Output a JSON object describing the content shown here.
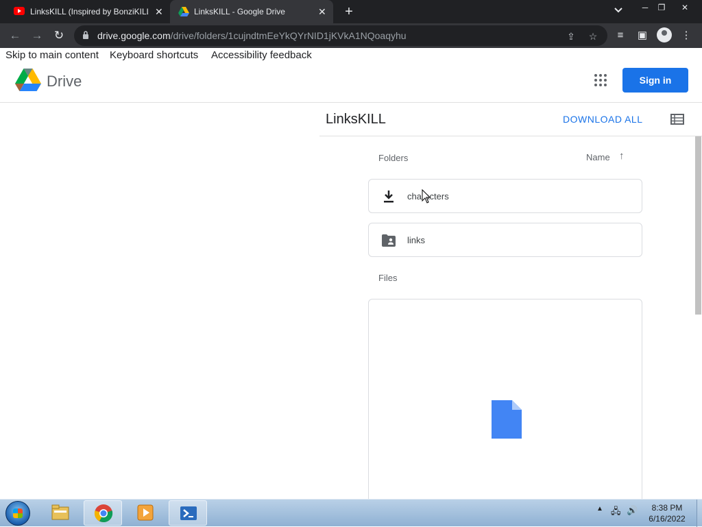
{
  "browser": {
    "tabs": [
      {
        "title": "LinksKILL (Inspired by BonziKILL)",
        "icon": "youtube-icon",
        "active": false
      },
      {
        "title": "LinksKILL - Google Drive",
        "icon": "google-drive-icon",
        "active": true
      }
    ],
    "url_domain": "drive.google.com",
    "url_path": "/drive/folders/1cujndtmEeYkQYrNID1jKVkA1NQoaqyhu"
  },
  "skip_links": [
    "Skip to main content",
    "Keyboard shortcuts",
    "Accessibility feedback"
  ],
  "header": {
    "logo_text": "Drive",
    "signin_label": "Sign in"
  },
  "folder": {
    "title": "LinksKILL",
    "download_all_label": "DOWNLOAD ALL"
  },
  "content": {
    "folders_label": "Folders",
    "sort_label": "Name",
    "files_label": "Files",
    "folders": [
      {
        "name": "characters",
        "icon": "download-icon"
      },
      {
        "name": "links",
        "icon": "shared-folder-icon"
      }
    ]
  },
  "taskbar": {
    "time": "8:38 PM",
    "date": "6/16/2022",
    "apps": [
      "file-explorer-icon",
      "chrome-icon",
      "media-player-icon",
      "powershell-icon"
    ]
  },
  "colors": {
    "accent": "#1a73e8",
    "tab_strip": "#202124",
    "active_tab": "#35363a"
  }
}
